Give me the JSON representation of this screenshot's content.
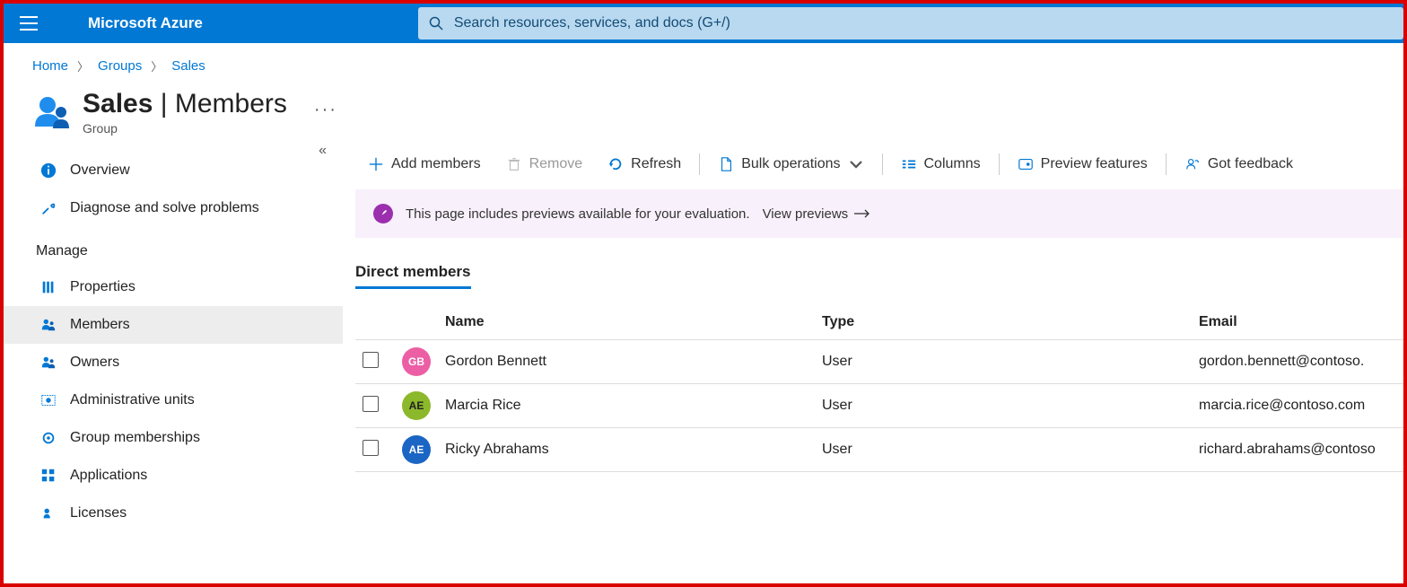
{
  "header": {
    "brand": "Microsoft Azure",
    "search_placeholder": "Search resources, services, and docs (G+/)"
  },
  "breadcrumbs": {
    "items": [
      "Home",
      "Groups",
      "Sales"
    ]
  },
  "title": {
    "group_name": "Sales",
    "section": "Members",
    "subtitle": "Group",
    "more": "···"
  },
  "sidebar": {
    "collapse_glyph": "«",
    "top": [
      {
        "label": "Overview",
        "icon": "info"
      },
      {
        "label": "Diagnose and solve problems",
        "icon": "wrench"
      }
    ],
    "manage_heading": "Manage",
    "manage": [
      {
        "label": "Properties",
        "icon": "props"
      },
      {
        "label": "Members",
        "icon": "people",
        "selected": true
      },
      {
        "label": "Owners",
        "icon": "people"
      },
      {
        "label": "Administrative units",
        "icon": "admin"
      },
      {
        "label": "Group memberships",
        "icon": "gear"
      },
      {
        "label": "Applications",
        "icon": "apps"
      },
      {
        "label": "Licenses",
        "icon": "license"
      }
    ]
  },
  "toolbar": {
    "add": "Add members",
    "remove": "Remove",
    "refresh": "Refresh",
    "bulk": "Bulk operations",
    "columns": "Columns",
    "preview": "Preview features",
    "feedback": "Got feedback"
  },
  "notice": {
    "text": "This page includes previews available for your evaluation. ",
    "link": "View previews"
  },
  "tabs": {
    "direct": "Direct members"
  },
  "table": {
    "headers": {
      "name": "Name",
      "type": "Type",
      "email": "Email"
    },
    "rows": [
      {
        "initials": "GB",
        "name": "Gordon Bennett",
        "type": "User",
        "email": "gordon.bennett@contoso.",
        "color": "pink"
      },
      {
        "initials": "AE",
        "name": "Marcia Rice",
        "type": "User",
        "email": "marcia.rice@contoso.com",
        "color": "green"
      },
      {
        "initials": "AE",
        "name": "Ricky Abrahams",
        "type": "User",
        "email": "richard.abrahams@contoso",
        "color": "blue"
      }
    ]
  }
}
